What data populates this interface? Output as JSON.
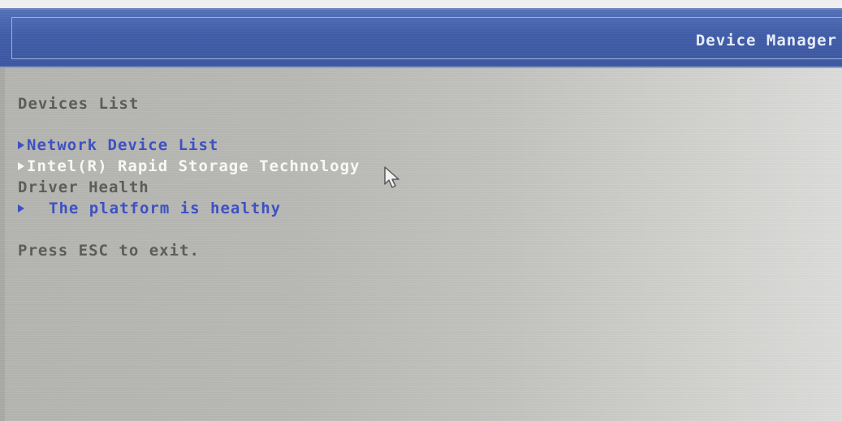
{
  "header": {
    "title": "Device Manager"
  },
  "main": {
    "section_title": "Devices List",
    "items": [
      {
        "label": "Network Device List"
      },
      {
        "label": "Intel(R) Rapid Storage Technology"
      }
    ],
    "health_title": "Driver Health",
    "health_item": {
      "label": "The platform is healthy"
    },
    "footer_hint": "Press ESC to exit."
  },
  "colors": {
    "title_bar": "#3f5ca8",
    "link": "#3a4fc4",
    "selected": "#fafafa",
    "text": "#5a5a5a",
    "background": "#b8b8b4"
  },
  "icons": {
    "menu_arrow": "right-triangle-icon",
    "pointer": "mouse-cursor-icon"
  }
}
